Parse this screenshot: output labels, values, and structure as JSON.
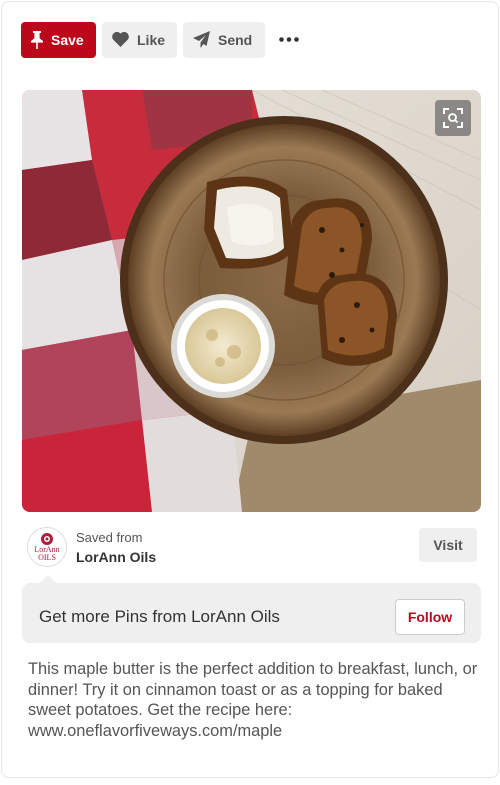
{
  "toolbar": {
    "save_label": "Save",
    "like_label": "Like",
    "send_label": "Send",
    "more_icon": "ellipsis-icon"
  },
  "pin_image": {
    "zoom_icon": "visual-search-icon"
  },
  "source": {
    "saved_from_label": "Saved from",
    "name": "LorAnn Oils",
    "logo_text_top": "LorAnn",
    "logo_text_bottom": "OILS",
    "visit_label": "Visit"
  },
  "follow": {
    "text": "Get more Pins from LorAnn Oils",
    "button_label": "Follow"
  },
  "description": "This maple butter is the perfect addition to breakfast, lunch, or dinner! Try it on cinnamon toast or as a topping for baked sweet potatoes. Get the recipe here: www.oneflavorfiveways.com/maple",
  "colors": {
    "brand_red": "#bd081c",
    "button_gray": "#efefef"
  }
}
